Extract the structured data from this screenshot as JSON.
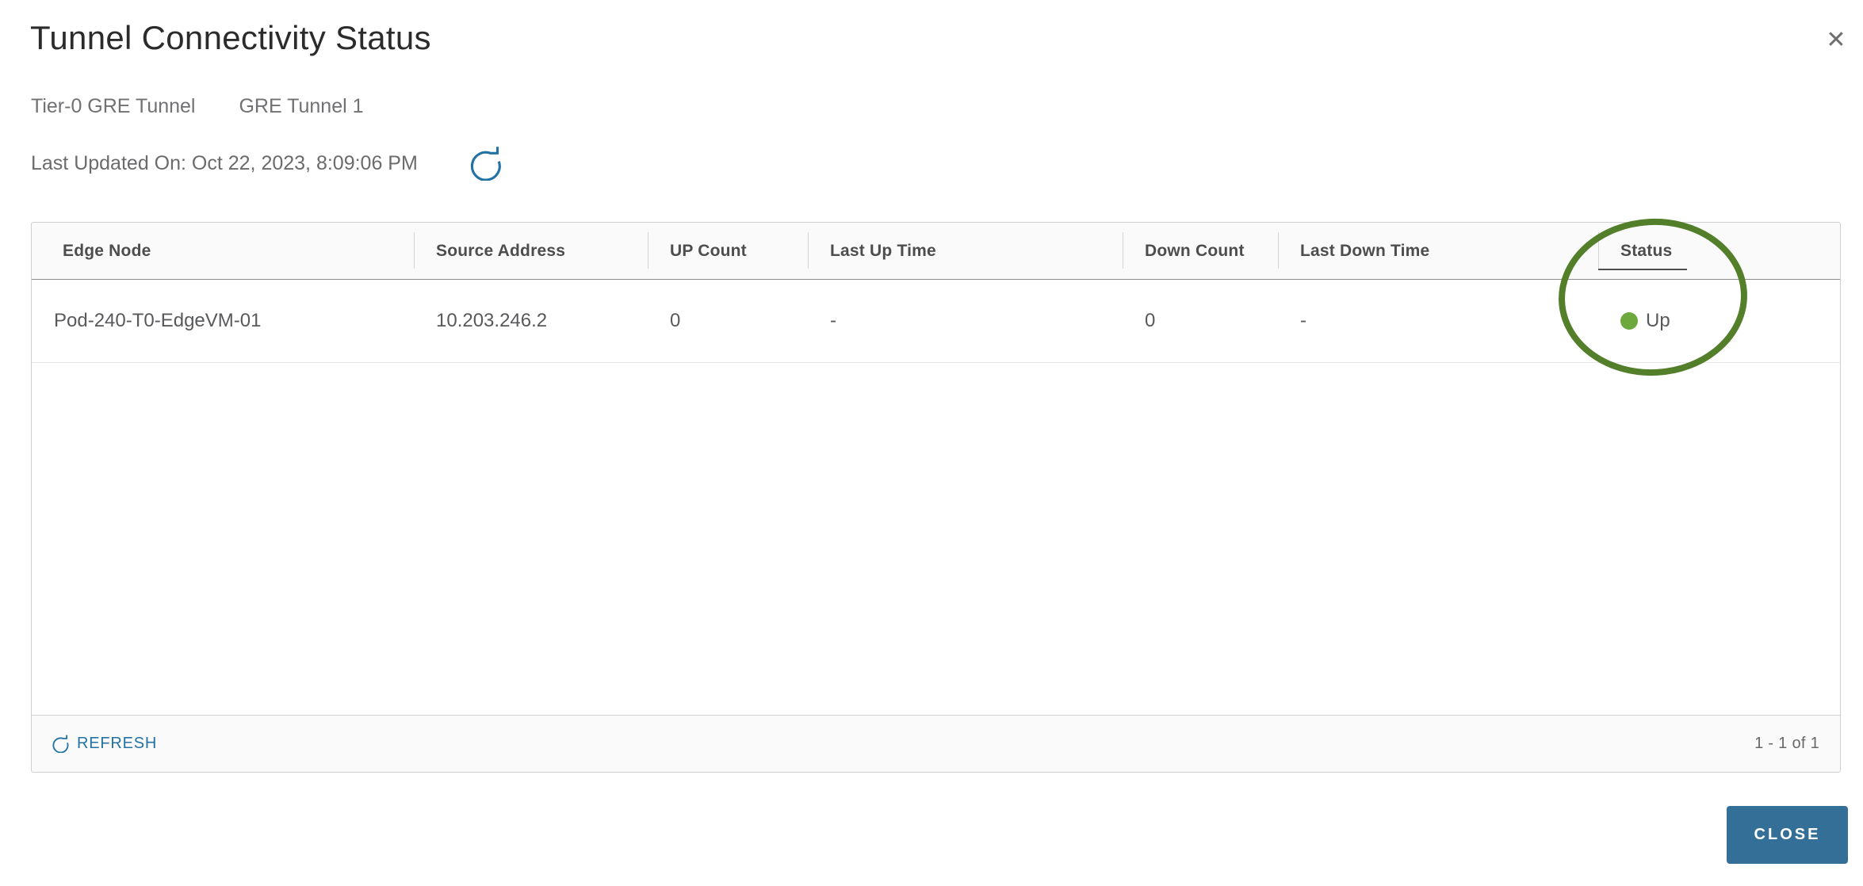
{
  "dialog": {
    "title": "Tunnel Connectivity Status",
    "close_icon": "✕",
    "tunnel_type": "Tier-0 GRE Tunnel",
    "tunnel_name": "GRE Tunnel 1",
    "last_updated": "Last Updated On: Oct 22, 2023, 8:09:06 PM",
    "close_button_label": "CLOSE"
  },
  "table": {
    "columns": [
      "Edge Node",
      "Source Address",
      "UP Count",
      "Last Up Time",
      "Down Count",
      "Last Down Time",
      "Status"
    ],
    "rows": [
      {
        "edge_node": "Pod-240-T0-EdgeVM-01",
        "source_address": "10.203.246.2",
        "up_count": "0",
        "last_up_time": "-",
        "down_count": "0",
        "last_down_time": "-",
        "status": "Up"
      }
    ],
    "footer": {
      "refresh_label": "REFRESH",
      "pagination": "1 - 1 of 1"
    }
  },
  "icons": {
    "refresh": "circular-arrow-clockwise",
    "close": "x-mark",
    "status_up": "green-dot"
  },
  "colors": {
    "link_blue": "#2272a3",
    "close_button_blue": "#336f96",
    "status_green": "#6ca83c",
    "annotation_green": "#537f2b"
  }
}
